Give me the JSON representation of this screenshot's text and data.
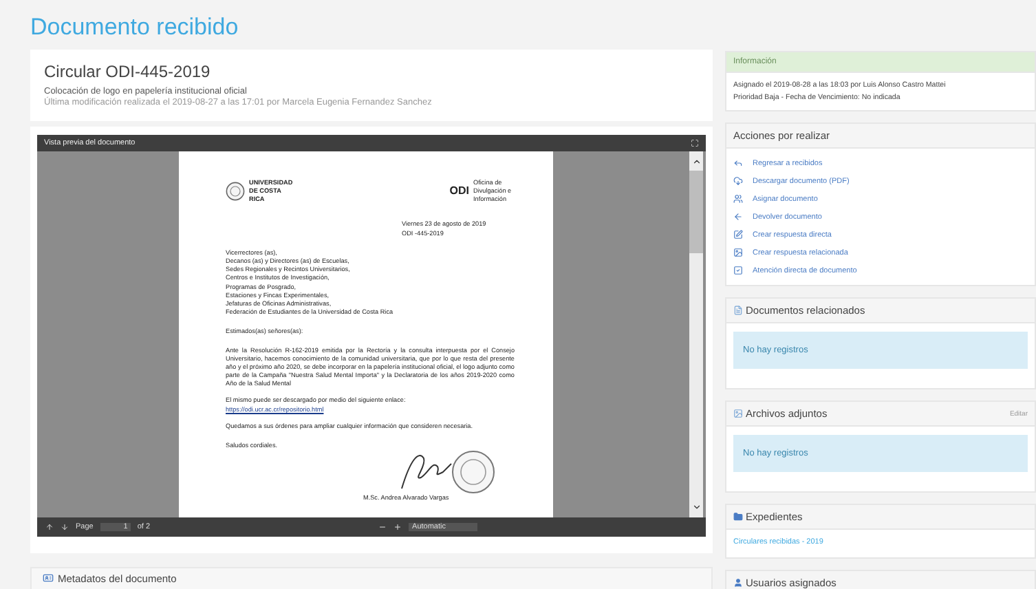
{
  "page_title": "Documento recibido",
  "document": {
    "title": "Circular ODI-445-2019",
    "subject": "Colocación de logo en papelería institucional oficial",
    "modified": "Última modificación realizada el 2019-08-27 a las 17:01 por Marcela Eugenia Fernandez Sanchez"
  },
  "preview": {
    "title": "Vista previa del documento",
    "letter": {
      "logo_left": "UNIVERSIDAD DE COSTA RICA",
      "logo_right_mark": "ODI",
      "logo_right_text": "Oficina de Divulgación e Información",
      "date_lines": [
        "Viernes 23 de agosto de 2019",
        "ODI -445-2019"
      ],
      "recipients": [
        "Vicerrectores (as),",
        "Decanos (as) y Directores (as) de Escuelas,",
        "Sedes Regionales y Recintos Universitarios,",
        "Centros e Institutos de Investigación,",
        "Programas de Posgrado,",
        "Estaciones y Fincas Experimentales,",
        "Jefaturas de Oficinas Administrativas,",
        "Federación de Estudiantes de la Universidad de Costa Rica"
      ],
      "greeting": "Estimados(as) señores(as):",
      "body": "Ante la Resolución R-162-2019 emitida por la Rectoría y la consulta interpuesta por el Consejo Universitario, hacemos conocimiento de la comunidad universitaria, que por lo que resta del presente año y el próximo año 2020, se debe incorporar en la papelería institucional oficial, el logo adjunto como parte de la Campaña \"Nuestra Salud Mental Importa\" y la Declaratoria de los años 2019-2020 como Año de la Salud Mental",
      "download": "El mismo puede ser descargado por medio del siguiente enlace:",
      "link": "https://odi.ucr.ac.cr/repositorio.html",
      "offer": "Quedamos a sus órdenes para ampliar cualquier información que consideren necesaria.",
      "farewell": "Saludos cordiales.",
      "signer": "M.Sc. Andrea Alvarado Vargas"
    },
    "toolbar": {
      "page_label": "Page",
      "page_value": "1",
      "page_total": "of 2",
      "zoom": "Automatic"
    }
  },
  "metadata_panel": {
    "title": "Metadatos del documento"
  },
  "info": {
    "title": "Información",
    "lines": [
      "Asignado el 2019-08-28 a las 18:03 por Luis Alonso Castro Mattei",
      "Prioridad Baja - Fecha de Vencimiento: No indicada"
    ]
  },
  "actions": {
    "title": "Acciones por realizar",
    "items": [
      {
        "label": "Regresar a recibidos"
      },
      {
        "label": "Descargar documento (PDF)"
      },
      {
        "label": "Asignar documento"
      },
      {
        "label": "Devolver documento"
      },
      {
        "label": "Crear respuesta directa"
      },
      {
        "label": "Crear respuesta relacionada"
      },
      {
        "label": "Atención directa de documento"
      }
    ]
  },
  "related": {
    "title": "Documentos relacionados",
    "empty": "No hay registros"
  },
  "attachments": {
    "title": "Archivos adjuntos",
    "edit": "Editar",
    "empty": "No hay registros"
  },
  "files": {
    "title": "Expedientes",
    "links": [
      "Circulares recibidas - 2019"
    ]
  },
  "users": {
    "title": "Usuarios asignados"
  }
}
